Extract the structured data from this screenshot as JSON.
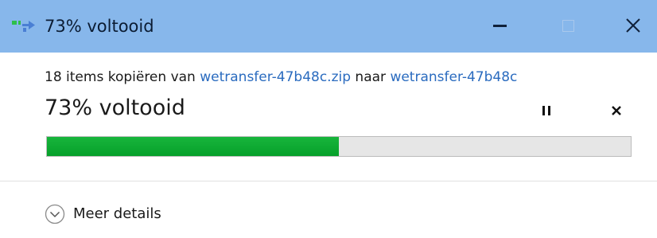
{
  "window": {
    "title": "73% voltooid",
    "title_icon": "copy-files-icon",
    "titlebar_color": "#87b7eb"
  },
  "controls": {
    "minimize_icon": "minimize-icon",
    "maximize_icon": "maximize-icon",
    "close_icon": "close-icon"
  },
  "transfer": {
    "prefix": "18 items kopiëren van ",
    "source": "wetransfer-47b48c.zip",
    "middle": " naar ",
    "destination": "wetransfer-47b48c",
    "status": "73% voltooid",
    "progress": 0.5,
    "progress_color": "#06a02a",
    "pause_icon": "pause-icon",
    "cancel_icon": "close-icon"
  },
  "details": {
    "label": "Meer details",
    "icon": "chevron-down-circle-icon"
  }
}
